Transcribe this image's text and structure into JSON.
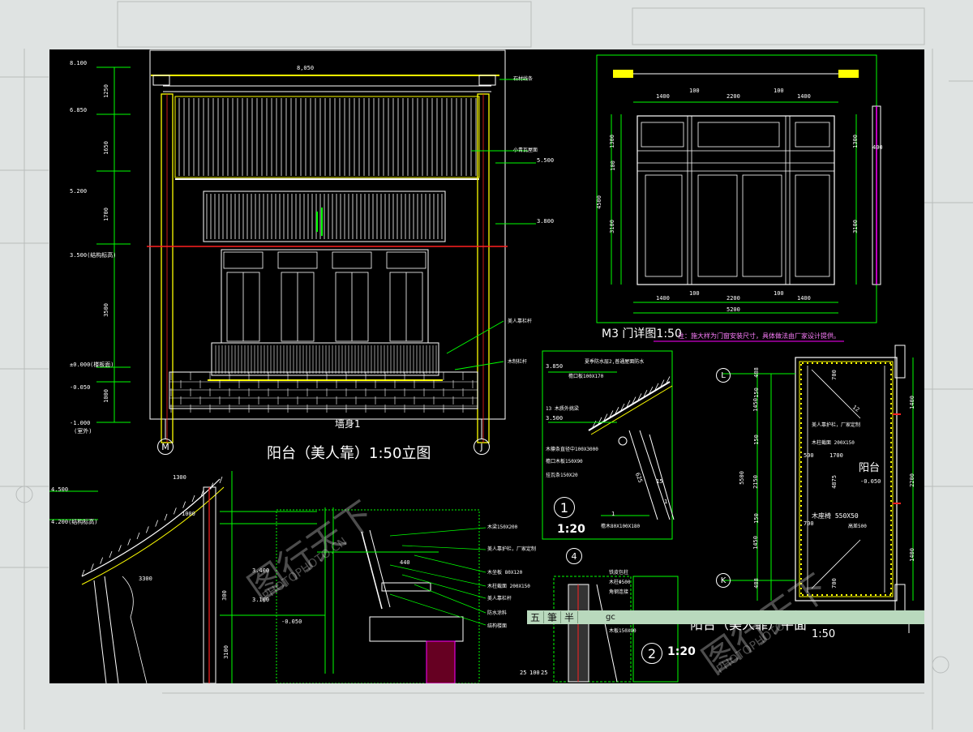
{
  "colors": {
    "cad_bg": "#000000",
    "outer_bg": "#dfe3e2",
    "green": "#00ff00",
    "yellow": "#ffff00",
    "red": "#ff2020",
    "white": "#ffffff",
    "magenta": "#ff00ff",
    "cyan": "#00ffff"
  },
  "elevation": {
    "title": "阳台（美人靠）1:50立图",
    "top_dim": "8,050",
    "wall_label": "墙身1",
    "axis_left": "M",
    "axis_right": "J",
    "levels": [
      "8.100",
      "6.850",
      "5.200",
      "3.500(结构标高)",
      "±0.000",
      "-0.050",
      "-1.000"
    ],
    "level_notes": [
      "(楼板面)",
      "(室外)"
    ],
    "vdims": [
      "1250",
      "1650",
      "1700",
      "3500",
      "1000"
    ],
    "right_levels": [
      "5.500",
      "3.800"
    ],
    "leaders": [
      "石材线条",
      "小青瓦屋面",
      "美人靠栏杆",
      "木制栏杆"
    ]
  },
  "door": {
    "title": "M3  门详图1:50",
    "note": "注：施大样为门窗安装尺寸，具体做法由厂家设计提供。",
    "top_dims": [
      "1400",
      "100",
      "2200",
      "100",
      "1400"
    ],
    "bottom_dims": [
      "1400",
      "100",
      "2200",
      "100",
      "1400"
    ],
    "total": "5200",
    "left_dims": [
      "1300",
      "100",
      "4500",
      "3100"
    ],
    "right_dims": [
      "1300",
      "400",
      "3100"
    ]
  },
  "detail1": {
    "num": "1",
    "scale": "1:20",
    "levels": [
      "3.850",
      "3.500"
    ],
    "notes": [
      "夏季防水层2,普通屋面防水",
      "檐口板100X170",
      "13 木质外挑梁",
      "木檩条直径中100X3000",
      "檐口木板150X90",
      "挂瓦条150X20",
      "檐木80X100X180"
    ],
    "dims": [
      "625",
      "15",
      "1",
      "1"
    ]
  },
  "plan": {
    "title": "阳台（美人靠）平面",
    "scale": "1:50",
    "axis_top": "L",
    "axis_bottom": "K",
    "label": "阳台",
    "level": "-0.050",
    "notes": [
      "美人靠护栏，厂家定制",
      "木柱截面 200X150",
      "木座椅 550X50",
      "高差500"
    ],
    "left_dims": [
      "488",
      "150",
      "1450",
      "150",
      "5500",
      "2150",
      "150",
      "1450",
      "488"
    ],
    "right_dims": [
      "1400",
      "2200",
      "1400"
    ],
    "inner": [
      "700",
      "500",
      "1700",
      "4875",
      "700",
      "700"
    ],
    "slope": "12"
  },
  "section": {
    "levels": [
      "4.500",
      "4.200(结构标高)",
      "3.400",
      "3.100",
      "-0.050"
    ],
    "dims": [
      "1300",
      "1000",
      "3300",
      "440",
      "3100",
      "300"
    ],
    "notes": [
      "木梁150X200",
      "美人靠护栏，厂家定制",
      "木坐板 80X120",
      "木柱截面 200X150",
      "美人靠栏杆",
      "防水涂料",
      "结构楼面"
    ],
    "bottom_dims": [
      "25",
      "100",
      "25"
    ],
    "num": "2",
    "scale": "1:20"
  },
  "detail4": {
    "num": "4",
    "notes": [
      "铁皮包柱",
      "木柱Φ500",
      "角钢连接",
      "木板150X90"
    ]
  },
  "ime": {
    "seg1": "五",
    "seg2": "筆",
    "seg3": "半",
    "code": "gc"
  },
  "watermark": {
    "text": "图行天下",
    "sub": "PHOTOPHOTO.CN"
  }
}
